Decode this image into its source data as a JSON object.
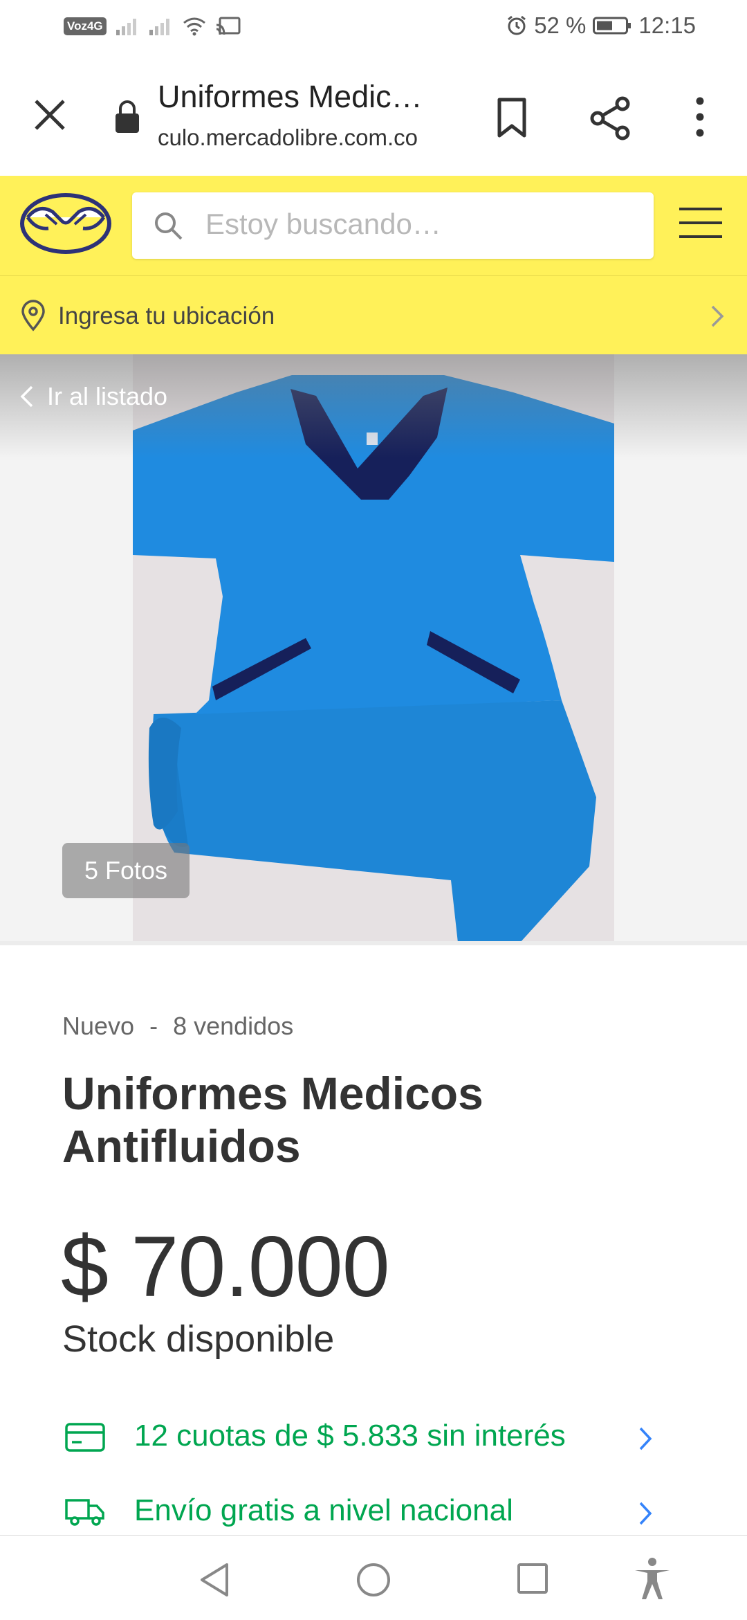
{
  "status_bar": {
    "network_badge": "Voz4G",
    "battery": "52 %",
    "time": "12:15"
  },
  "browser": {
    "page_title": "Uniformes Medic…",
    "url": "culo.mercadolibre.com.co"
  },
  "header": {
    "search_placeholder": "Estoy buscando…",
    "brand_color": "#fff159"
  },
  "location": {
    "label": "Ingresa tu ubicación"
  },
  "gallery": {
    "back_label": "Ir al listado",
    "photos_label": "5 Fotos"
  },
  "product": {
    "condition": "Nuevo",
    "separator": "-",
    "sold": "8 vendidos",
    "title": "Uniformes Medicos Antifluidos",
    "price": "$ 70.000",
    "stock": "Stock disponible"
  },
  "benefits": [
    {
      "text": "12 cuotas de $ 5.833 sin interés",
      "icon": "credit-card-icon"
    },
    {
      "text": "Envío gratis a nivel nacional",
      "icon": "truck-icon"
    }
  ],
  "colors": {
    "accent_green": "#00a650",
    "chevron_blue": "#3483fa"
  }
}
